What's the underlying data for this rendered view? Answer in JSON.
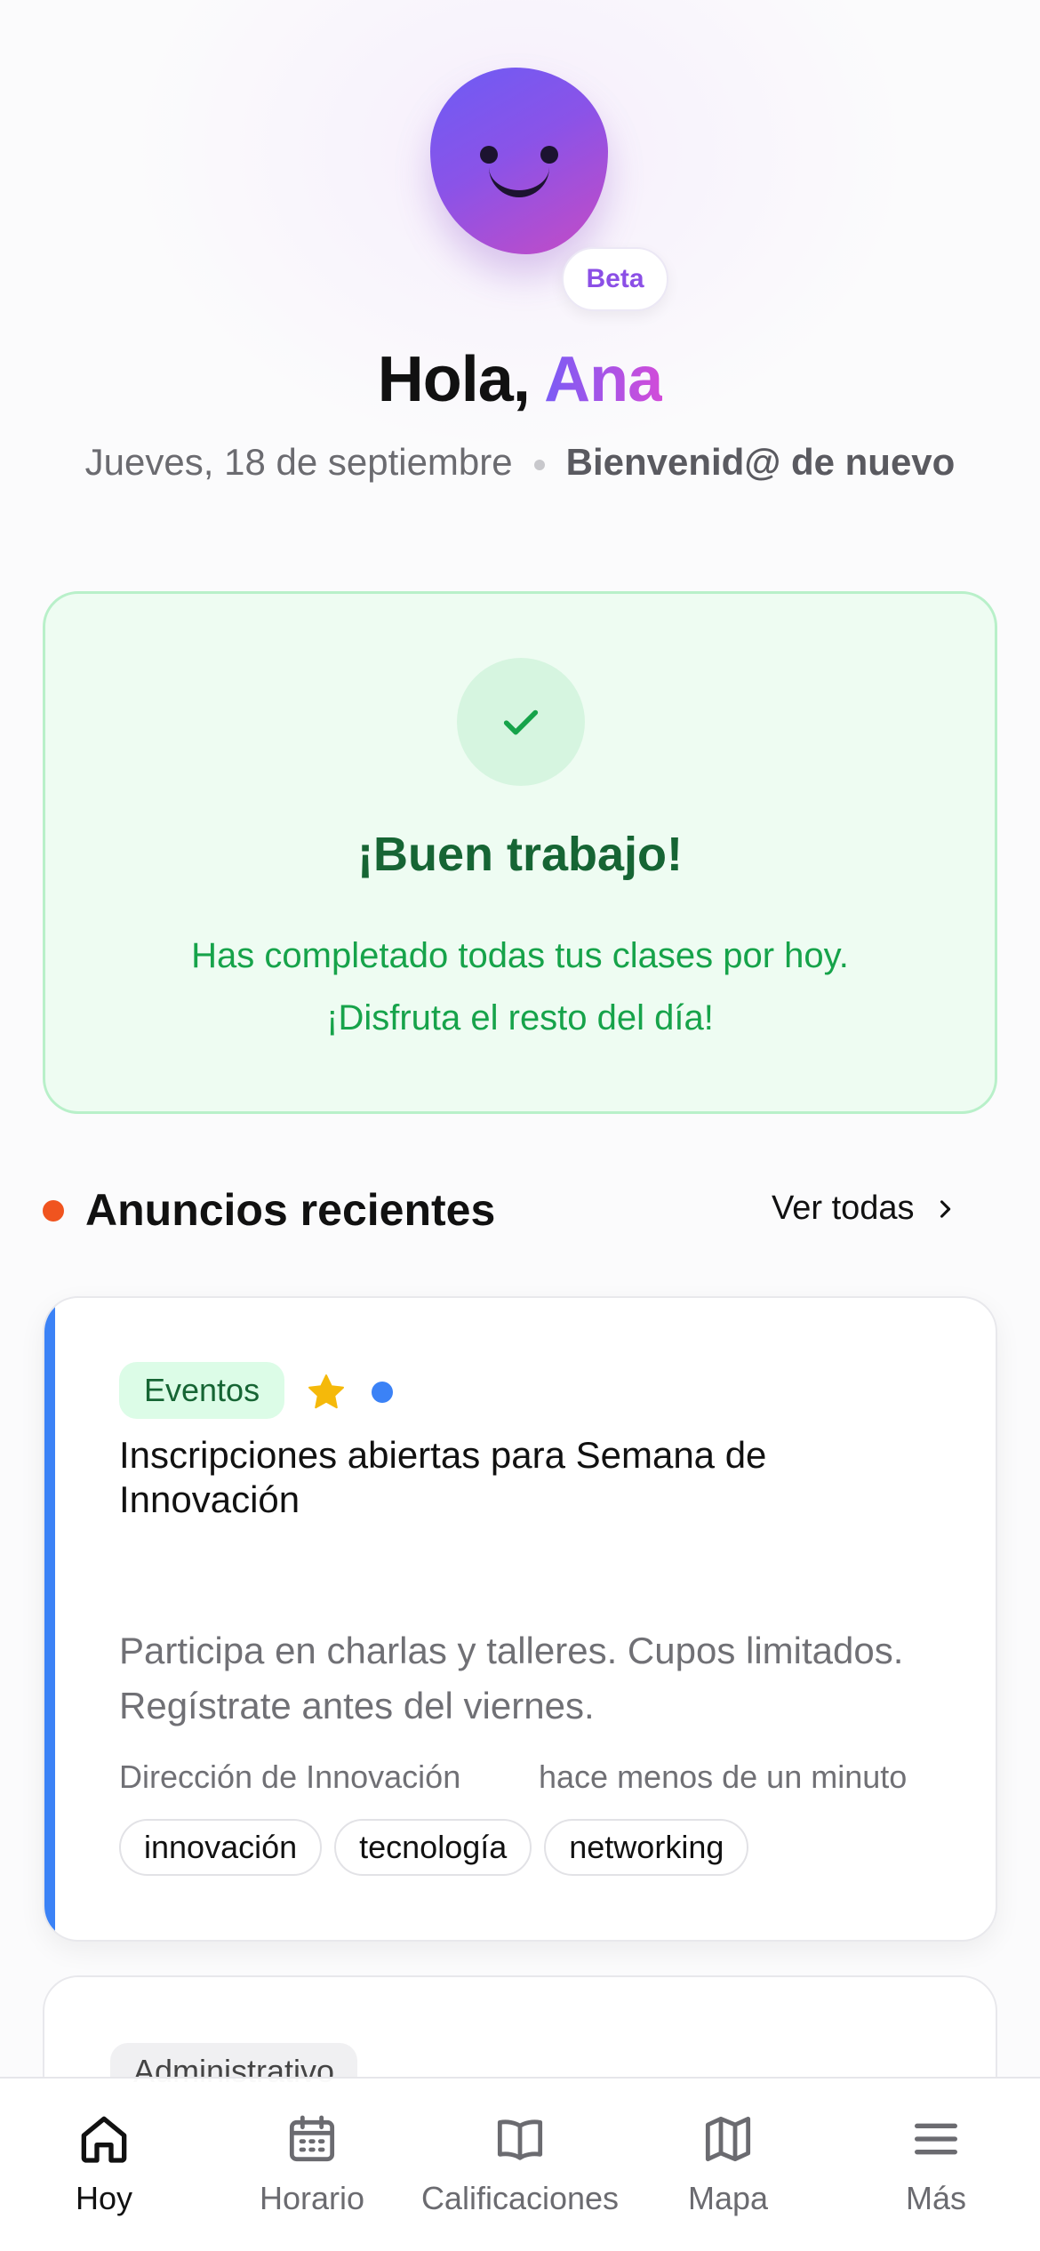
{
  "header": {
    "badge": "Beta",
    "greeting_prefix": "Hola, ",
    "user_name": "Ana",
    "date": "Jueves, 18 de septiembre",
    "welcome": "Bienvenid@ de nuevo"
  },
  "status_card": {
    "title": "¡Buen trabajo!",
    "message_line1": "Has completado todas tus clases por hoy.",
    "message_line2": "¡Disfruta el resto del día!",
    "icon": "check-icon"
  },
  "announcements": {
    "section_title": "Anuncios recientes",
    "see_all": "Ver todas",
    "items": [
      {
        "category": "Eventos",
        "starred": true,
        "unread": true,
        "title": "Inscripciones abiertas para Semana de Innovación",
        "body": "Participa en charlas y talleres. Cupos limitados. Regístrate antes del viernes.",
        "author": "Dirección de Innovación",
        "time": "hace menos de un minuto",
        "tags": [
          "innovación",
          "tecnología",
          "networking"
        ],
        "accent_color": "#3b82f6"
      },
      {
        "category": "Administrativo"
      }
    ]
  },
  "tabbar": {
    "tabs": [
      {
        "label": "Hoy",
        "icon": "home-icon",
        "active": true
      },
      {
        "label": "Horario",
        "icon": "calendar-icon",
        "active": false
      },
      {
        "label": "Calificaciones",
        "icon": "book-icon",
        "active": false
      },
      {
        "label": "Mapa",
        "icon": "map-icon",
        "active": false
      },
      {
        "label": "Más",
        "icon": "menu-icon",
        "active": false
      }
    ]
  }
}
